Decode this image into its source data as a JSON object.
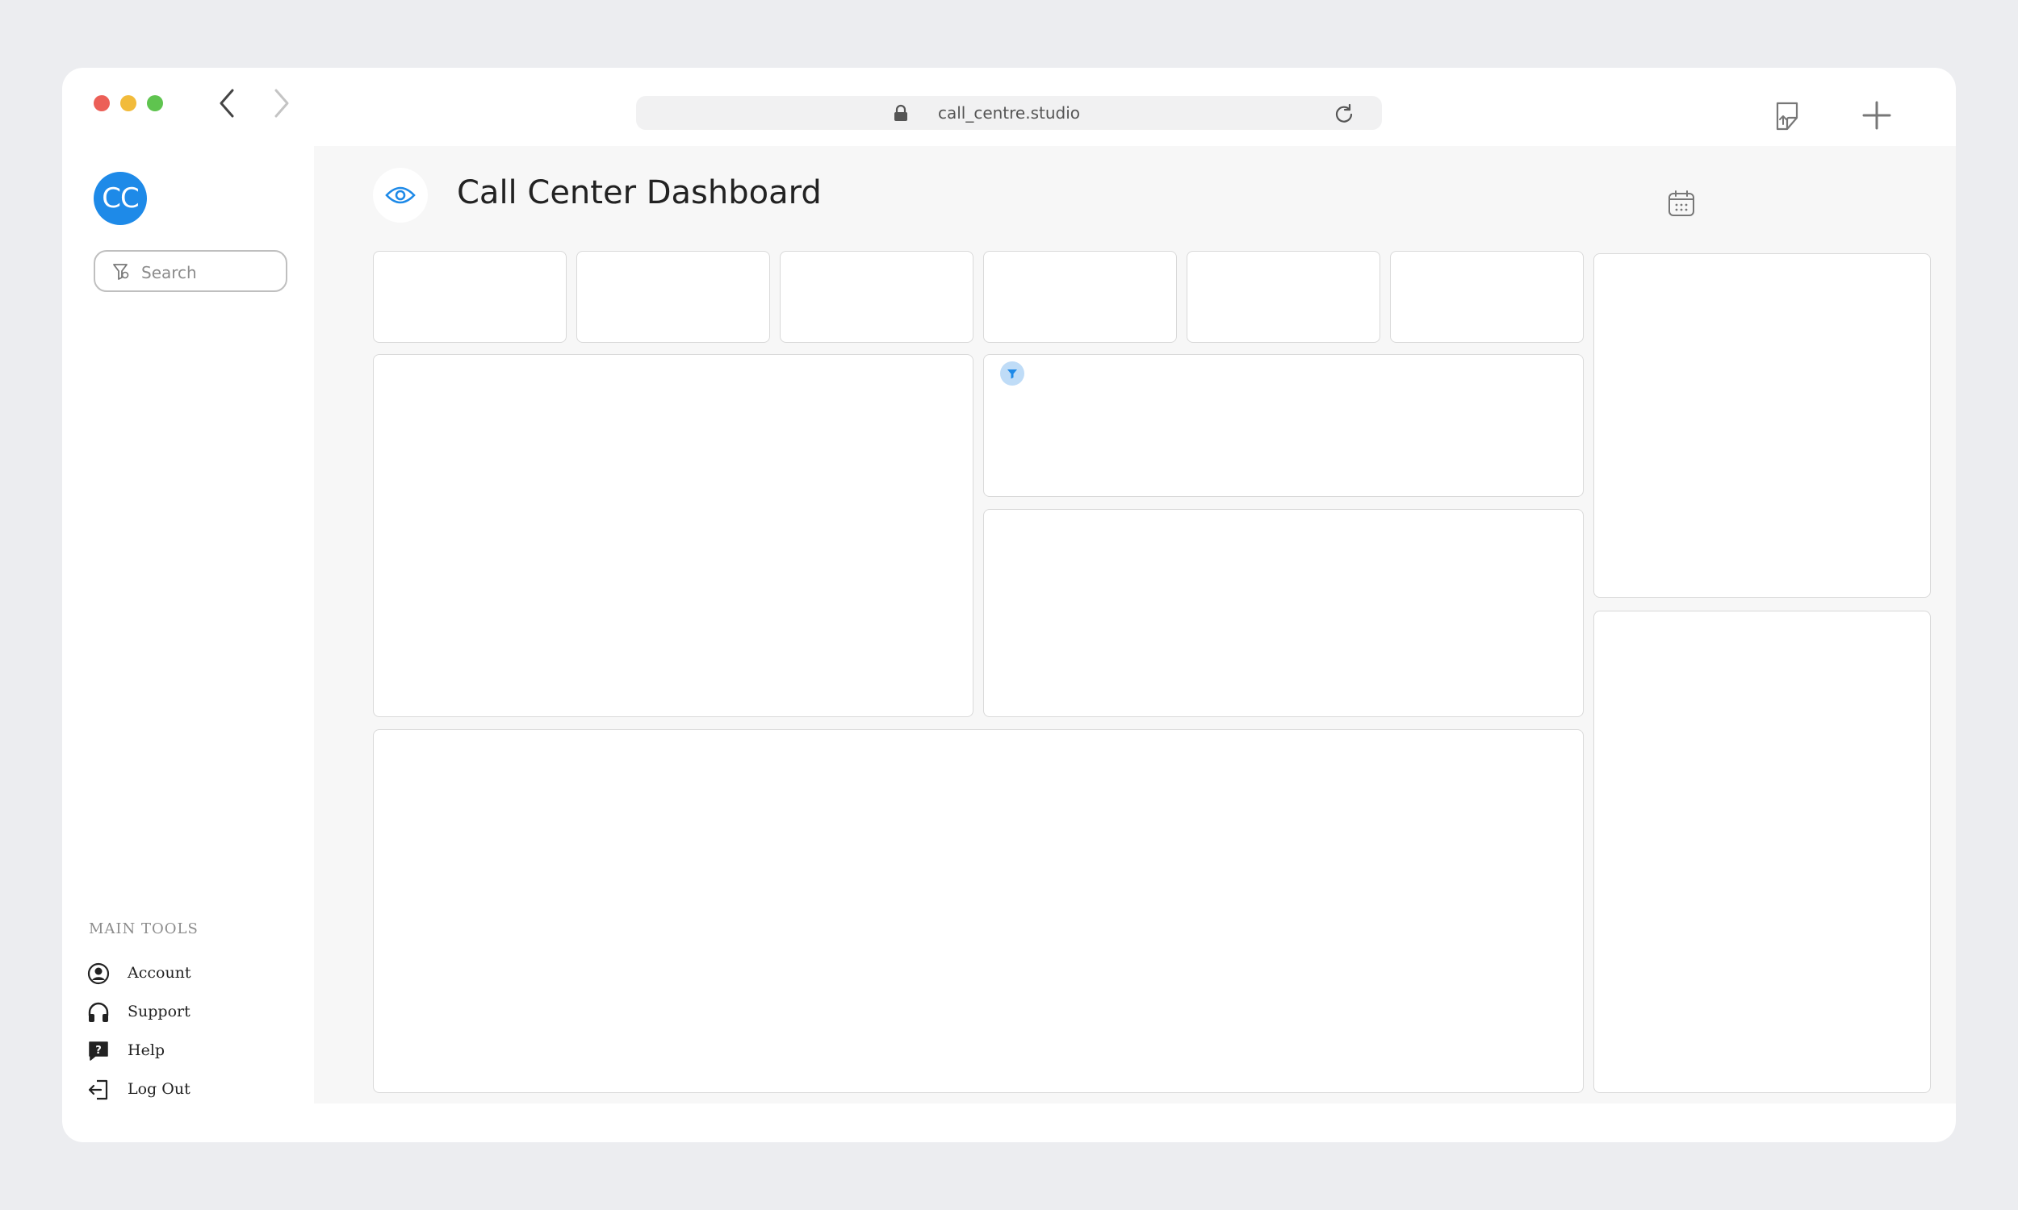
{
  "browser": {
    "url": "call_centre.studio"
  },
  "sidebar": {
    "avatar_initials": "CC",
    "search_placeholder": "Search",
    "section_title": "MAIN TOOLS",
    "items": [
      {
        "label": "Account",
        "icon": "account-circle-icon"
      },
      {
        "label": "Support",
        "icon": "headphones-icon"
      },
      {
        "label": "Help",
        "icon": "help-chat-icon"
      },
      {
        "label": "Log Out",
        "icon": "logout-icon"
      }
    ]
  },
  "header": {
    "title": "Call Center Dashboard",
    "title_icon": "eye-icon",
    "calendar_icon": "calendar-icon"
  },
  "colors": {
    "accent": "#1E8AE8",
    "main_bg": "#F7F7F7",
    "page_bg": "#ECEDF0"
  }
}
